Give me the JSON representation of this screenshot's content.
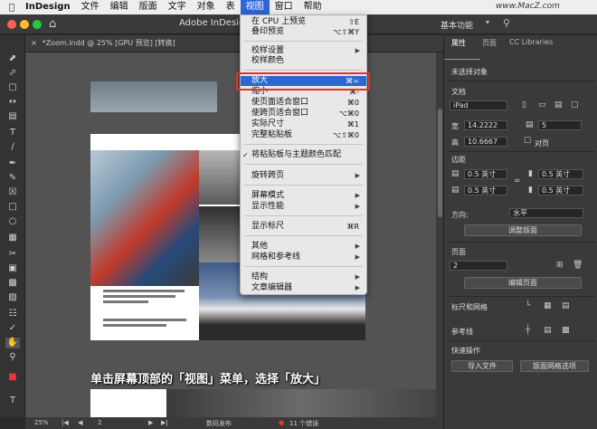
{
  "menubar": {
    "app": "InDesign",
    "items": [
      "文件",
      "编辑",
      "版面",
      "文字",
      "对象",
      "表",
      "视图",
      "窗口",
      "帮助"
    ],
    "active": "视图"
  },
  "titlebar": {
    "title": "Adobe InDesign",
    "workspace": "基本功能",
    "watermark": "www.MacZ.com"
  },
  "doc_tab": {
    "close": "×",
    "name": "*Zoom.indd @ 25% [GPU 预览] [转换]"
  },
  "view_menu": [
    {
      "label": "在 CPU 上预览",
      "shortcut": "⇧E"
    },
    {
      "label": "叠印预览",
      "shortcut": "⌥⇧⌘Y"
    },
    {
      "label": "校样设置",
      "shortcut": "▶"
    },
    {
      "label": "校样颜色",
      "shortcut": ""
    },
    {
      "label": "放大",
      "shortcut": "⌘="
    },
    {
      "label": "缩小",
      "shortcut": "⌘-"
    },
    {
      "label": "使页面适合窗口",
      "shortcut": "⌘0"
    },
    {
      "label": "使跨页适合窗口",
      "shortcut": "⌥⌘0"
    },
    {
      "label": "实际尺寸",
      "shortcut": "⌘1"
    },
    {
      "label": "完整粘贴板",
      "shortcut": "⌥⇧⌘0"
    },
    {
      "label": "将粘贴板与主题颜色匹配",
      "shortcut": "",
      "check": "✓"
    },
    {
      "label": "旋转跨页",
      "shortcut": "▶"
    },
    {
      "label": "屏幕模式",
      "shortcut": "▶"
    },
    {
      "label": "显示性能",
      "shortcut": "▶"
    },
    {
      "label": "显示标尺",
      "shortcut": "⌘R"
    },
    {
      "label": "其他",
      "shortcut": "▶"
    },
    {
      "label": "网格和参考线",
      "shortcut": "▶"
    },
    {
      "label": "结构",
      "shortcut": "▶"
    },
    {
      "label": "文章编辑器",
      "shortcut": "▶"
    }
  ],
  "panel": {
    "tabs": [
      "属性",
      "页面",
      "CC Libraries"
    ],
    "no_selection": "未选择对象",
    "document_label": "文档",
    "preset": "iPad",
    "width_label": "宽",
    "width": "14.2222",
    "height_label": "高",
    "height": "10.6667",
    "pages_count": "5",
    "facing_pages": "对页",
    "margins_label": "边距",
    "margin_value": "0.5 英寸",
    "direction_label": "方向:",
    "direction_value": "水平",
    "adjust_layout": "调整版面",
    "page_section": "页面",
    "page_number": "2",
    "edit_page": "编辑页面",
    "rulers_grids": "标尺和网格",
    "guides": "参考线",
    "quick_actions": "快速操作",
    "import_file": "导入文件",
    "layout_grid_options": "版面网格选项"
  },
  "statusbar": {
    "zoom": "25%",
    "page": "2",
    "style": "数码发布",
    "errors": "11 个错误"
  },
  "caption": "单击屏幕顶部的「视图」菜单，选择「放大」"
}
